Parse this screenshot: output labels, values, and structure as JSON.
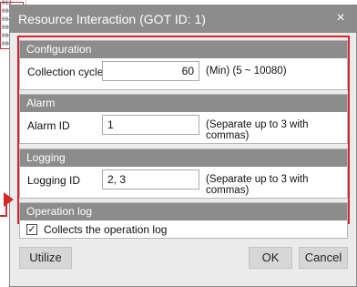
{
  "background_pane": {
    "rows": [
      "012",
      "000",
      "004",
      "000",
      "006",
      "000"
    ]
  },
  "dialog": {
    "title": "Resource Interaction (GOT ID: 1)",
    "close_glyph": "×",
    "configuration": {
      "header": "Configuration",
      "collection_cycle_label": "Collection cycle",
      "collection_cycle_value": "60",
      "collection_cycle_hint": "(Min)   (5 ~ 10080)"
    },
    "alarm": {
      "header": "Alarm",
      "alarm_id_label": "Alarm ID",
      "alarm_id_value": "1",
      "alarm_id_hint": "(Separate up to 3 with commas)"
    },
    "logging": {
      "header": "Logging",
      "logging_id_label": "Logging ID",
      "logging_id_value": "2, 3",
      "logging_id_hint": "(Separate up to 3 with commas)"
    },
    "operation_log": {
      "header": "Operation log",
      "collect_label": "Collects the operation log",
      "collect_checked_glyph": "✓"
    },
    "buttons": {
      "utilize": "Utilize",
      "ok": "OK",
      "cancel": "Cancel"
    }
  },
  "colors": {
    "accent_red": "#d9242f",
    "header_gray": "#8c8c8c"
  }
}
